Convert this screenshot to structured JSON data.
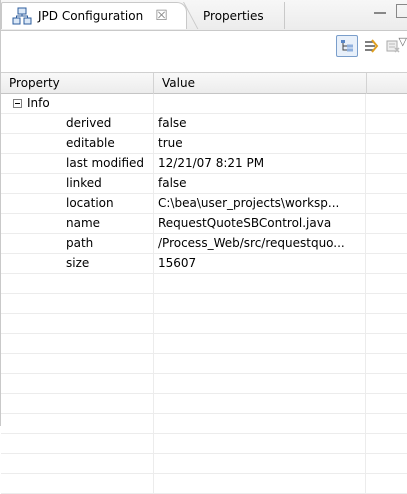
{
  "tabs": [
    {
      "label": "JPD Configuration",
      "close_glyph": "☒",
      "icon": "jpd-config-icon"
    },
    {
      "label": "Properties"
    }
  ],
  "toolbar": {
    "buttons": [
      "show-categories-icon",
      "show-advanced-properties-icon",
      "restore-default-icon"
    ],
    "menu_glyph": "▽"
  },
  "table": {
    "columns": [
      "Property",
      "Value"
    ],
    "group": {
      "label": "Info",
      "expanded": true
    },
    "rows": [
      {
        "property": "derived",
        "value": "false"
      },
      {
        "property": "editable",
        "value": "true"
      },
      {
        "property": "last modified",
        "value": "12/21/07 8:21 PM"
      },
      {
        "property": "linked",
        "value": "false"
      },
      {
        "property": "location",
        "value": "C:\\bea\\user_projects\\worksp..."
      },
      {
        "property": "name",
        "value": "RequestQuoteSBControl.java"
      },
      {
        "property": "path",
        "value": "/Process_Web/src/requestquo..."
      },
      {
        "property": "size",
        "value": "15607"
      }
    ]
  },
  "colors": {
    "tab_border": "#c9c9c9",
    "pressed_button": "#7a9ecb",
    "grid": "#ececec"
  }
}
